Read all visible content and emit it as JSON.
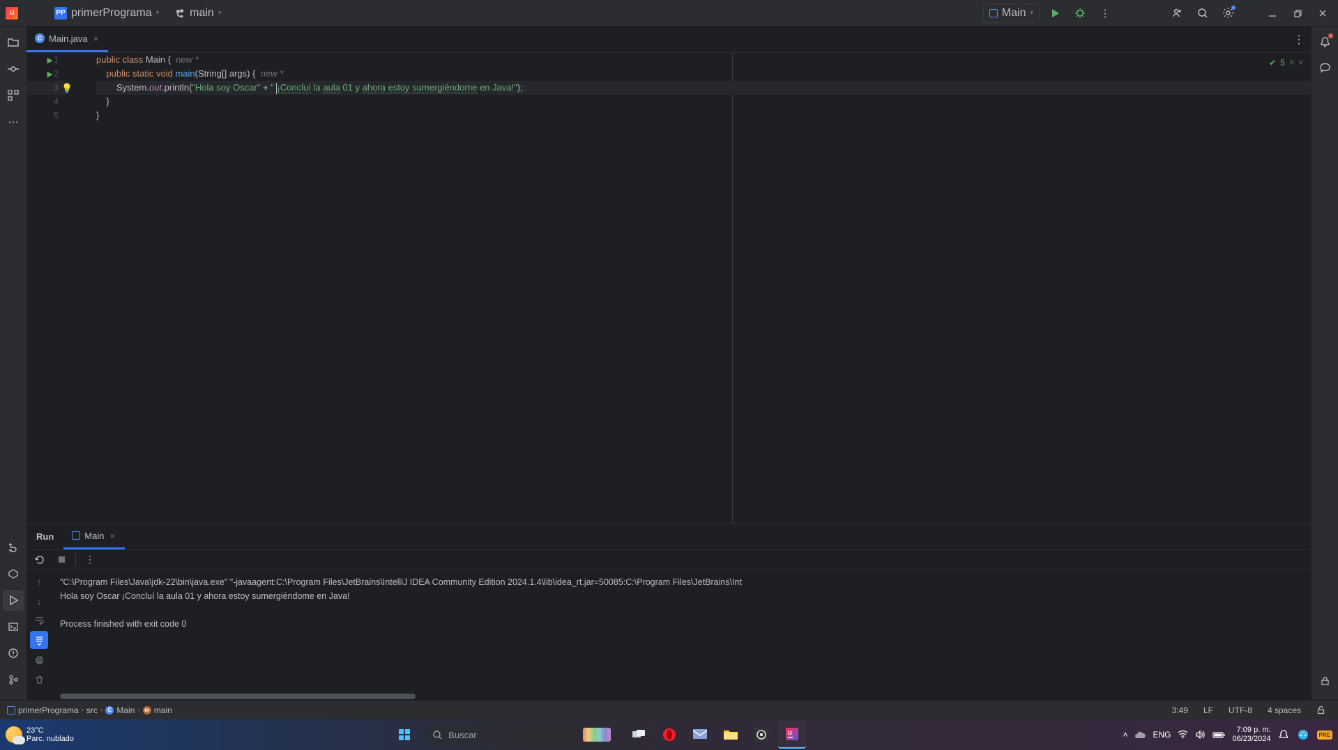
{
  "titlebar": {
    "project_name": "primerPrograma",
    "project_badge": "PP",
    "branch": "main",
    "run_config": "Main"
  },
  "tabs": {
    "file": "Main.java"
  },
  "editor": {
    "hint1": "new *",
    "hint2": "new *",
    "inspections_count": "5",
    "line1_kw1": "public ",
    "line1_kw2": "class ",
    "line1_cls": "Main",
    "line1_brace": " {",
    "line2_pad": "    ",
    "line2_kw1": "public ",
    "line2_kw2": "static ",
    "line2_kw3": "void ",
    "line2_mth": "main",
    "line2_paren": "(",
    "line2_typ": "String[] args",
    "line2_end": ") {",
    "line3_pad": "        ",
    "line3_sys": "System.",
    "line3_out": "out",
    "line3_prn": ".println(",
    "line3_str1": "\"Hola soy Oscar\"",
    "line3_plus": " + ",
    "line3_str_open": "\" ",
    "line3_typo1": "¡Concluí",
    "line3_sp1": " la ",
    "line3_typo2": "aula",
    "line3_sp2": " 01 y ",
    "line3_typo3": "ahora",
    "line3_sp3": " ",
    "line3_typo4": "estoy",
    "line3_sp4": " ",
    "line3_typo5": "sumergiéndome",
    "line3_sp5": " en Java!\"",
    "line3_end": ");",
    "line4_pad": "    ",
    "line4_brace": "}",
    "line5_brace": "}",
    "caret_position": "3:49"
  },
  "gutter": {
    "n1": "1",
    "n2": "2",
    "n3": "3",
    "n4": "4",
    "n5": "5"
  },
  "runpanel": {
    "title": "Run",
    "config": "Main",
    "console_line1": "\"C:\\Program Files\\Java\\jdk-22\\bin\\java.exe\" \"-javaagent:C:\\Program Files\\JetBrains\\IntelliJ IDEA Community Edition 2024.1.4\\lib\\idea_rt.jar=50085:C:\\Program Files\\JetBrains\\Int",
    "console_line2": "Hola soy Oscar ¡Concluí la aula 01 y ahora estoy sumergiéndome en Java!",
    "console_line4": "Process finished with exit code 0"
  },
  "statusbar": {
    "crumb_proj": "primerPrograma",
    "crumb_src": "src",
    "crumb_class": "Main",
    "crumb_method": "main",
    "pos": "3:49",
    "le": "LF",
    "enc": "UTF-8",
    "indent": "4 spaces"
  },
  "taskbar": {
    "temp": "23°C",
    "cond": "Parc. nublado",
    "search_placeholder": "Buscar",
    "lang": "ENG",
    "time": "7:09 p. m.",
    "date": "06/23/2024"
  }
}
